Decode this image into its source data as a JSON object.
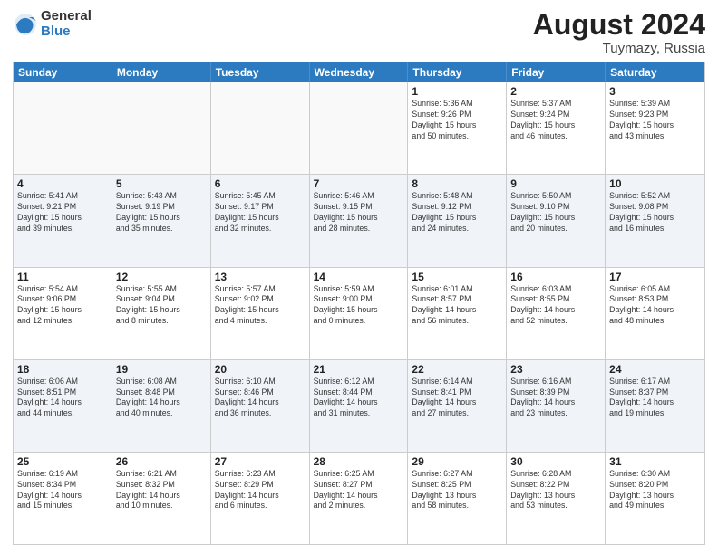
{
  "logo": {
    "general": "General",
    "blue": "Blue"
  },
  "title": "August 2024",
  "location": "Tuymazy, Russia",
  "days": [
    "Sunday",
    "Monday",
    "Tuesday",
    "Wednesday",
    "Thursday",
    "Friday",
    "Saturday"
  ],
  "rows": [
    [
      {
        "day": "",
        "info": "",
        "empty": true
      },
      {
        "day": "",
        "info": "",
        "empty": true
      },
      {
        "day": "",
        "info": "",
        "empty": true
      },
      {
        "day": "",
        "info": "",
        "empty": true
      },
      {
        "day": "1",
        "info": "Sunrise: 5:36 AM\nSunset: 9:26 PM\nDaylight: 15 hours\nand 50 minutes.",
        "empty": false
      },
      {
        "day": "2",
        "info": "Sunrise: 5:37 AM\nSunset: 9:24 PM\nDaylight: 15 hours\nand 46 minutes.",
        "empty": false
      },
      {
        "day": "3",
        "info": "Sunrise: 5:39 AM\nSunset: 9:23 PM\nDaylight: 15 hours\nand 43 minutes.",
        "empty": false
      }
    ],
    [
      {
        "day": "4",
        "info": "Sunrise: 5:41 AM\nSunset: 9:21 PM\nDaylight: 15 hours\nand 39 minutes.",
        "empty": false
      },
      {
        "day": "5",
        "info": "Sunrise: 5:43 AM\nSunset: 9:19 PM\nDaylight: 15 hours\nand 35 minutes.",
        "empty": false
      },
      {
        "day": "6",
        "info": "Sunrise: 5:45 AM\nSunset: 9:17 PM\nDaylight: 15 hours\nand 32 minutes.",
        "empty": false
      },
      {
        "day": "7",
        "info": "Sunrise: 5:46 AM\nSunset: 9:15 PM\nDaylight: 15 hours\nand 28 minutes.",
        "empty": false
      },
      {
        "day": "8",
        "info": "Sunrise: 5:48 AM\nSunset: 9:12 PM\nDaylight: 15 hours\nand 24 minutes.",
        "empty": false
      },
      {
        "day": "9",
        "info": "Sunrise: 5:50 AM\nSunset: 9:10 PM\nDaylight: 15 hours\nand 20 minutes.",
        "empty": false
      },
      {
        "day": "10",
        "info": "Sunrise: 5:52 AM\nSunset: 9:08 PM\nDaylight: 15 hours\nand 16 minutes.",
        "empty": false
      }
    ],
    [
      {
        "day": "11",
        "info": "Sunrise: 5:54 AM\nSunset: 9:06 PM\nDaylight: 15 hours\nand 12 minutes.",
        "empty": false
      },
      {
        "day": "12",
        "info": "Sunrise: 5:55 AM\nSunset: 9:04 PM\nDaylight: 15 hours\nand 8 minutes.",
        "empty": false
      },
      {
        "day": "13",
        "info": "Sunrise: 5:57 AM\nSunset: 9:02 PM\nDaylight: 15 hours\nand 4 minutes.",
        "empty": false
      },
      {
        "day": "14",
        "info": "Sunrise: 5:59 AM\nSunset: 9:00 PM\nDaylight: 15 hours\nand 0 minutes.",
        "empty": false
      },
      {
        "day": "15",
        "info": "Sunrise: 6:01 AM\nSunset: 8:57 PM\nDaylight: 14 hours\nand 56 minutes.",
        "empty": false
      },
      {
        "day": "16",
        "info": "Sunrise: 6:03 AM\nSunset: 8:55 PM\nDaylight: 14 hours\nand 52 minutes.",
        "empty": false
      },
      {
        "day": "17",
        "info": "Sunrise: 6:05 AM\nSunset: 8:53 PM\nDaylight: 14 hours\nand 48 minutes.",
        "empty": false
      }
    ],
    [
      {
        "day": "18",
        "info": "Sunrise: 6:06 AM\nSunset: 8:51 PM\nDaylight: 14 hours\nand 44 minutes.",
        "empty": false
      },
      {
        "day": "19",
        "info": "Sunrise: 6:08 AM\nSunset: 8:48 PM\nDaylight: 14 hours\nand 40 minutes.",
        "empty": false
      },
      {
        "day": "20",
        "info": "Sunrise: 6:10 AM\nSunset: 8:46 PM\nDaylight: 14 hours\nand 36 minutes.",
        "empty": false
      },
      {
        "day": "21",
        "info": "Sunrise: 6:12 AM\nSunset: 8:44 PM\nDaylight: 14 hours\nand 31 minutes.",
        "empty": false
      },
      {
        "day": "22",
        "info": "Sunrise: 6:14 AM\nSunset: 8:41 PM\nDaylight: 14 hours\nand 27 minutes.",
        "empty": false
      },
      {
        "day": "23",
        "info": "Sunrise: 6:16 AM\nSunset: 8:39 PM\nDaylight: 14 hours\nand 23 minutes.",
        "empty": false
      },
      {
        "day": "24",
        "info": "Sunrise: 6:17 AM\nSunset: 8:37 PM\nDaylight: 14 hours\nand 19 minutes.",
        "empty": false
      }
    ],
    [
      {
        "day": "25",
        "info": "Sunrise: 6:19 AM\nSunset: 8:34 PM\nDaylight: 14 hours\nand 15 minutes.",
        "empty": false
      },
      {
        "day": "26",
        "info": "Sunrise: 6:21 AM\nSunset: 8:32 PM\nDaylight: 14 hours\nand 10 minutes.",
        "empty": false
      },
      {
        "day": "27",
        "info": "Sunrise: 6:23 AM\nSunset: 8:29 PM\nDaylight: 14 hours\nand 6 minutes.",
        "empty": false
      },
      {
        "day": "28",
        "info": "Sunrise: 6:25 AM\nSunset: 8:27 PM\nDaylight: 14 hours\nand 2 minutes.",
        "empty": false
      },
      {
        "day": "29",
        "info": "Sunrise: 6:27 AM\nSunset: 8:25 PM\nDaylight: 13 hours\nand 58 minutes.",
        "empty": false
      },
      {
        "day": "30",
        "info": "Sunrise: 6:28 AM\nSunset: 8:22 PM\nDaylight: 13 hours\nand 53 minutes.",
        "empty": false
      },
      {
        "day": "31",
        "info": "Sunrise: 6:30 AM\nSunset: 8:20 PM\nDaylight: 13 hours\nand 49 minutes.",
        "empty": false
      }
    ]
  ]
}
